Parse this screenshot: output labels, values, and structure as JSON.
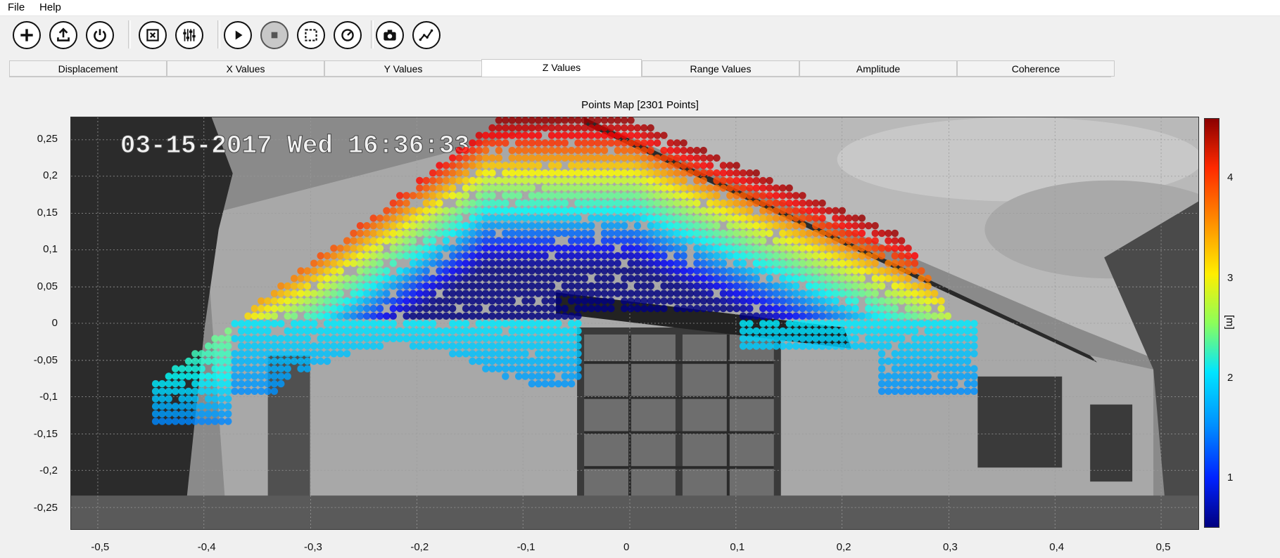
{
  "menu": {
    "file": "File",
    "help": "Help"
  },
  "toolbar": {
    "buttons": [
      {
        "name": "add-icon",
        "disabled": false
      },
      {
        "name": "upload-icon",
        "disabled": false
      },
      {
        "name": "power-icon",
        "disabled": false
      },
      {
        "name": "box-x-icon",
        "disabled": false
      },
      {
        "name": "sliders-icon",
        "disabled": false
      },
      {
        "name": "play-icon",
        "disabled": false
      },
      {
        "name": "stop-icon",
        "disabled": true
      },
      {
        "name": "select-region-icon",
        "disabled": false
      },
      {
        "name": "timer-icon",
        "disabled": false
      },
      {
        "name": "camera-icon",
        "disabled": false
      },
      {
        "name": "chart-line-icon",
        "disabled": false
      }
    ]
  },
  "tabs": [
    "Displacement",
    "X Values",
    "Y Values",
    "Z Values",
    "Range Values",
    "Amplitude",
    "Coherence"
  ],
  "active_tab": "Z Values",
  "plot": {
    "title": "Points Map [2301 Points]",
    "overlay_text": "03-15-2017 Wed 16:36:33",
    "colorbar_label": "[m]"
  },
  "chart_data": {
    "type": "scatter",
    "title": "Points Map [2301 Points]",
    "point_count": 2301,
    "xlim": [
      -0.53,
      0.53
    ],
    "ylim": [
      -0.28,
      0.28
    ],
    "x_ticks": [
      "-0,5",
      "-0,4",
      "-0,3",
      "-0,2",
      "-0,1",
      "0",
      "0,1",
      "0,2",
      "0,3",
      "0,4",
      "0,5"
    ],
    "y_ticks": [
      "0,25",
      "0,2",
      "0,15",
      "0,1",
      "0,05",
      "0",
      "-0,05",
      "-0,1",
      "-0,15",
      "-0,2",
      "-0,25"
    ],
    "colorbar": {
      "label": "[m]",
      "ticks": [
        "4",
        "3",
        "2",
        "1"
      ],
      "range": [
        0.5,
        4.6
      ],
      "colormap": "jet"
    },
    "grid": true
  }
}
